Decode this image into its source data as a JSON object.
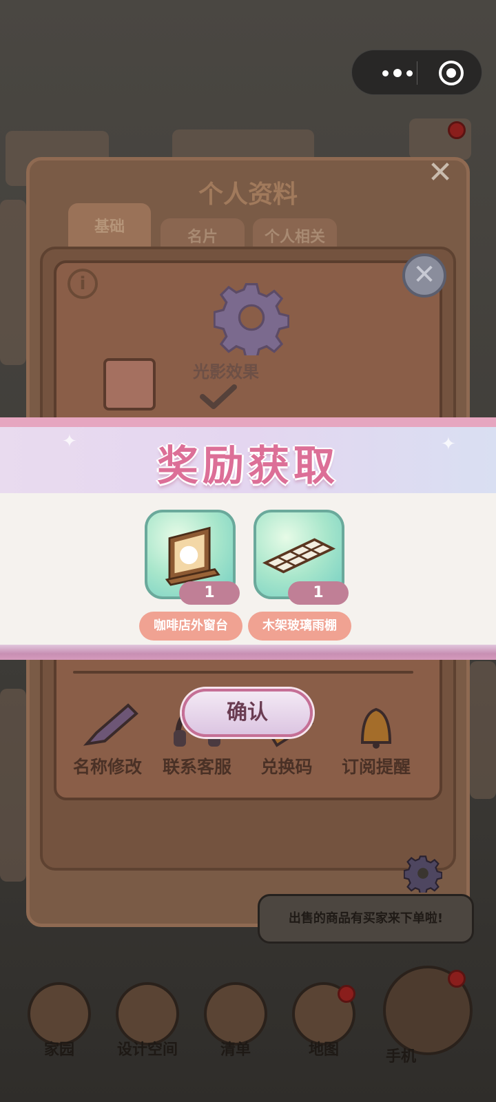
{
  "wechat_capsule": {
    "more_icon": "more-dots-icon",
    "close_icon": "target-circle-icon"
  },
  "profile_panel": {
    "title": "个人资料",
    "tabs": [
      {
        "label": "基础",
        "active": true
      },
      {
        "label": "名片",
        "active": false
      },
      {
        "label": "个人相关",
        "active": false
      }
    ]
  },
  "settings_panel": {
    "light_effect_label": "光影效果",
    "actions": [
      {
        "label": "名称修改",
        "icon": "pencil-icon"
      },
      {
        "label": "联系客服",
        "icon": "headset-icon"
      },
      {
        "label": "兑换码",
        "icon": "ticket-icon"
      },
      {
        "label": "订阅提醒",
        "icon": "bell-icon"
      }
    ]
  },
  "notification_bubble": {
    "text": "出售的商品有买家来下单啦!"
  },
  "bottom_nav": [
    {
      "label": "家园",
      "icon": "home-icon"
    },
    {
      "label": "设计空间",
      "icon": "ruler-icon"
    },
    {
      "label": "清单",
      "icon": "list-icon"
    },
    {
      "label": "地图",
      "icon": "map-pin-icon"
    },
    {
      "label": "手机",
      "icon": "phone-icon"
    }
  ],
  "reward_modal": {
    "title": "奖励获取",
    "items": [
      {
        "name": "咖啡店外窗台",
        "count": "1",
        "icon": "window-sill-icon"
      },
      {
        "name": "木架玻璃雨棚",
        "count": "1",
        "icon": "glass-canopy-icon"
      }
    ],
    "confirm_label": "确认"
  },
  "colors": {
    "reward_title": "#dc6f97",
    "item_card": "#a8e6cb",
    "item_name_bg": "#f0a292",
    "item_count_bg": "#c07f96",
    "confirm_border": "#c56f96"
  }
}
